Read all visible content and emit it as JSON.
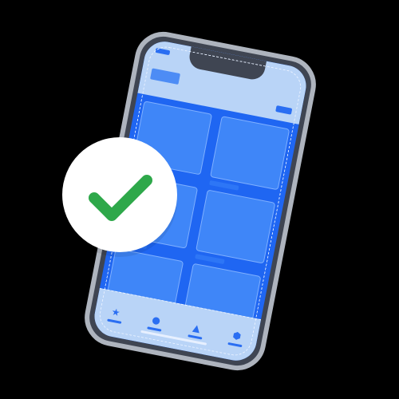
{
  "colors": {
    "background": "#000000",
    "phone_frame": "#3f4552",
    "phone_bezel": "#aeb4be",
    "screen_blue": "#1f66f2",
    "card_blue": "#3f86f8",
    "light_blue": "#b9d4f7",
    "check_green": "#2ea84a",
    "badge_white": "#ffffff"
  },
  "phone": {
    "cards_count": 6,
    "tabs": [
      {
        "icon": "★"
      },
      {
        "icon": "●"
      },
      {
        "icon": "▲"
      },
      {
        "icon": "⬢"
      }
    ]
  },
  "badge": {
    "icon": "checkmark-icon"
  }
}
